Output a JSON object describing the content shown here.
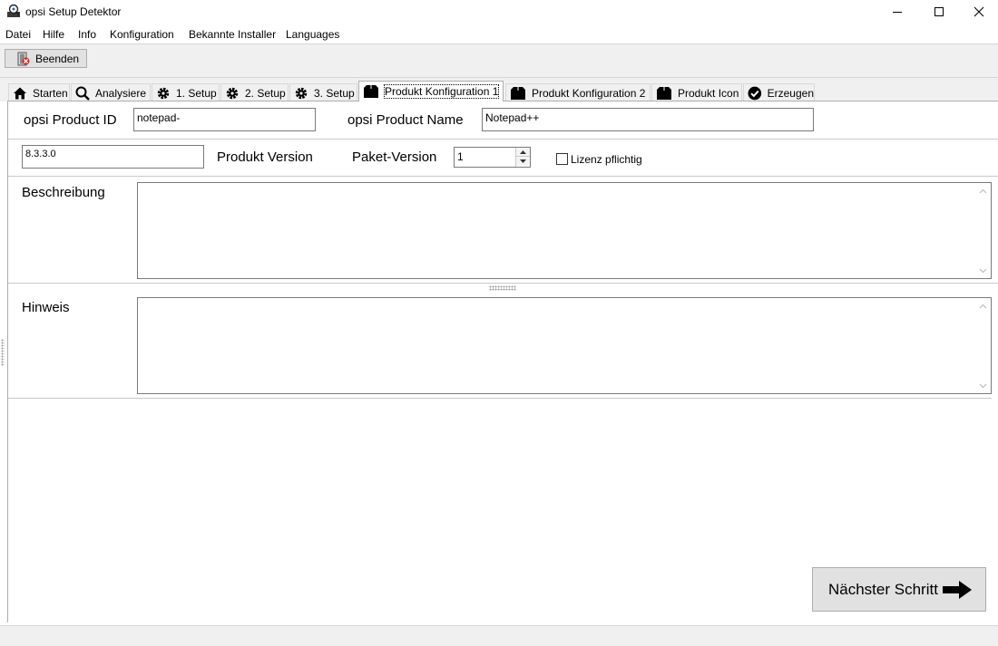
{
  "window": {
    "title": "opsi Setup Detektor",
    "app_icon": "opsi-detector-icon",
    "controls": [
      "minimize-icon",
      "maximize-icon",
      "close-icon"
    ]
  },
  "menu": {
    "items": [
      "Datei",
      "Hilfe",
      "Info",
      "Konfiguration",
      "Bekannte Installer",
      "Languages"
    ]
  },
  "toolbar": {
    "quit_label": "Beenden",
    "quit_icon": "door-exit-icon"
  },
  "tabs": [
    {
      "label": "Starten",
      "icon": "home-icon",
      "active": false
    },
    {
      "label": "Analysiere",
      "icon": "search-icon",
      "active": false
    },
    {
      "label": "1. Setup",
      "icon": "gear-icon",
      "active": false
    },
    {
      "label": "2. Setup",
      "icon": "gear-icon",
      "active": false
    },
    {
      "label": "3. Setup",
      "icon": "gear-icon",
      "active": false
    },
    {
      "label": "Produkt Konfiguration 1",
      "icon": "box-icon",
      "active": true
    },
    {
      "label": "Produkt Konfiguration 2",
      "icon": "box-icon",
      "active": false
    },
    {
      "label": "Produkt Icon",
      "icon": "box-icon",
      "active": false
    },
    {
      "label": "Erzeugen",
      "icon": "check-circle-icon",
      "active": false
    }
  ],
  "form": {
    "product_id_label": "opsi Product ID",
    "product_id_value": "notepad-",
    "product_name_label": "opsi Product Name",
    "product_name_value": "Notepad++",
    "product_version_value": "8.3.3.0",
    "product_version_label": "Produkt Version",
    "package_version_label": "Paket-Version",
    "package_version_value": "1",
    "license_label": "Lizenz pflichtig",
    "license_checked": false,
    "description_label": "Beschreibung",
    "description_value": "",
    "advice_label": "Hinweis",
    "advice_value": ""
  },
  "next_button": {
    "label": "Nächster Schritt",
    "icon": "arrow-right-icon"
  }
}
